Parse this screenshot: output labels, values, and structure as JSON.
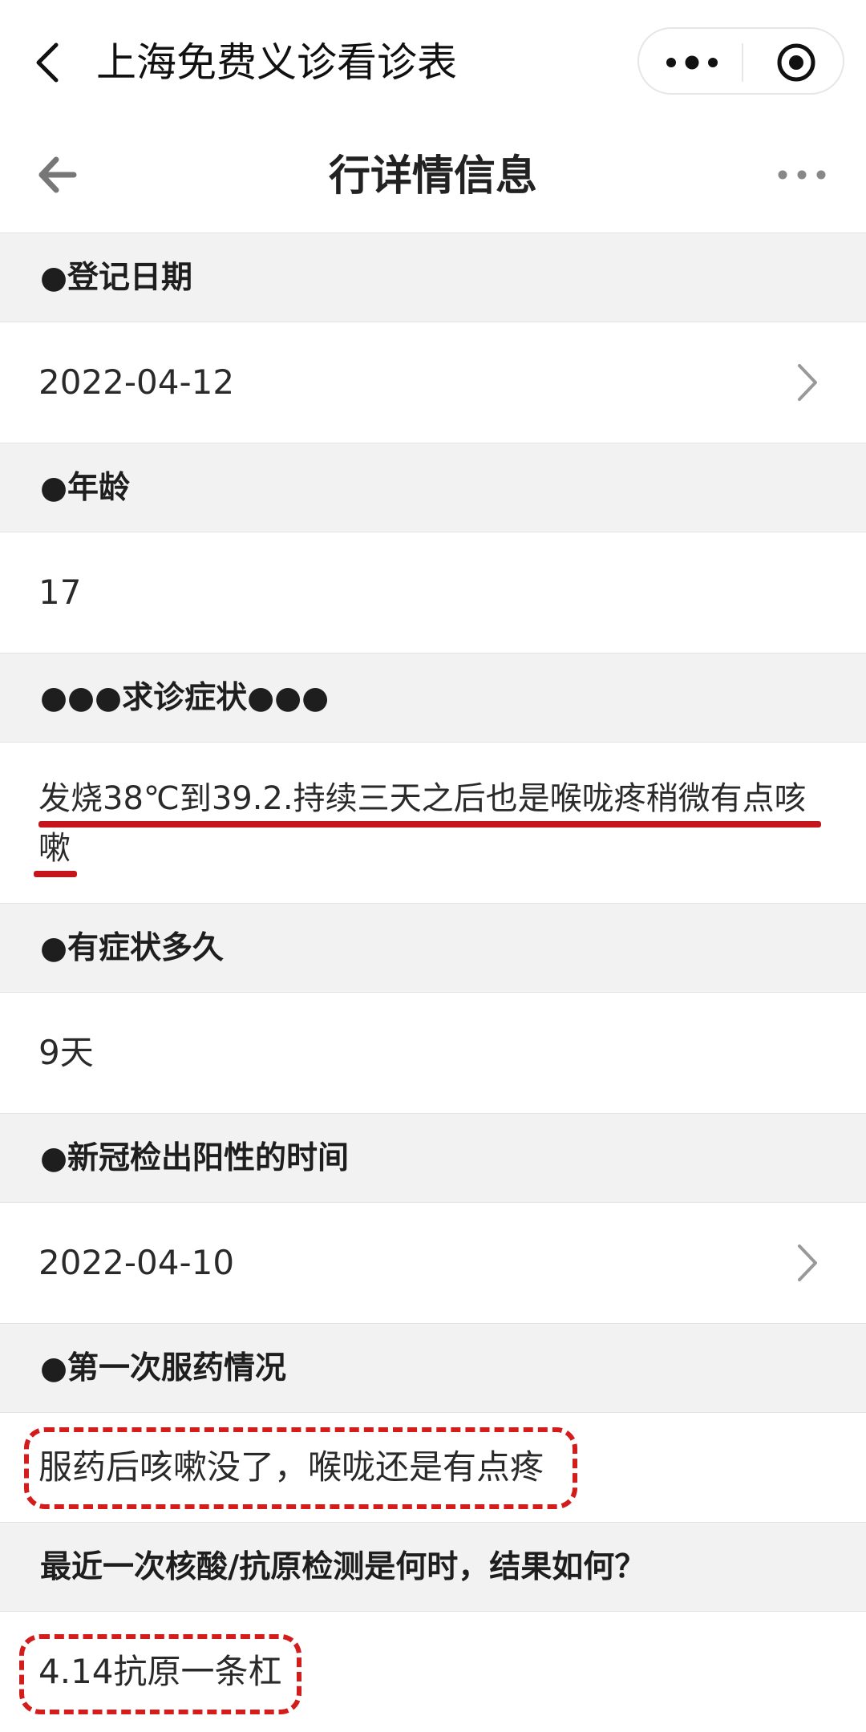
{
  "mini_program": {
    "title": "上海免费义诊看诊表",
    "back_icon": "chevron-left-icon",
    "more_icon": "more-dots-icon",
    "close_icon": "target-circle-icon"
  },
  "header": {
    "title": "行详情信息",
    "back_icon": "arrow-left-icon",
    "more_icon": "more-dots-icon"
  },
  "fields": [
    {
      "label": "●登记日期",
      "value": "2022-04-12",
      "chevron": true
    },
    {
      "label": "●年龄",
      "value": "17",
      "chevron": false
    },
    {
      "label": "●●●求诊症状●●●",
      "value_lines": [
        "发烧38℃到39.2.持续三天之后也是喉咙疼稍微有点咳",
        "嗽"
      ]
    },
    {
      "label": "●有症状多久",
      "value": "9天",
      "chevron": false
    },
    {
      "label": "●新冠检出阳性的时间",
      "value": "2022-04-10",
      "chevron": true
    },
    {
      "label": "●第一次服药情况",
      "value": "服药后咳嗽没了，喉咙还是有点疼"
    },
    {
      "label": "最近一次核酸/抗原检测是何时，结果如何？",
      "value": "4.14抗原一条杠"
    }
  ],
  "colors": {
    "annotation_red": "#c4161c",
    "section_bg": "#f2f2f2"
  }
}
